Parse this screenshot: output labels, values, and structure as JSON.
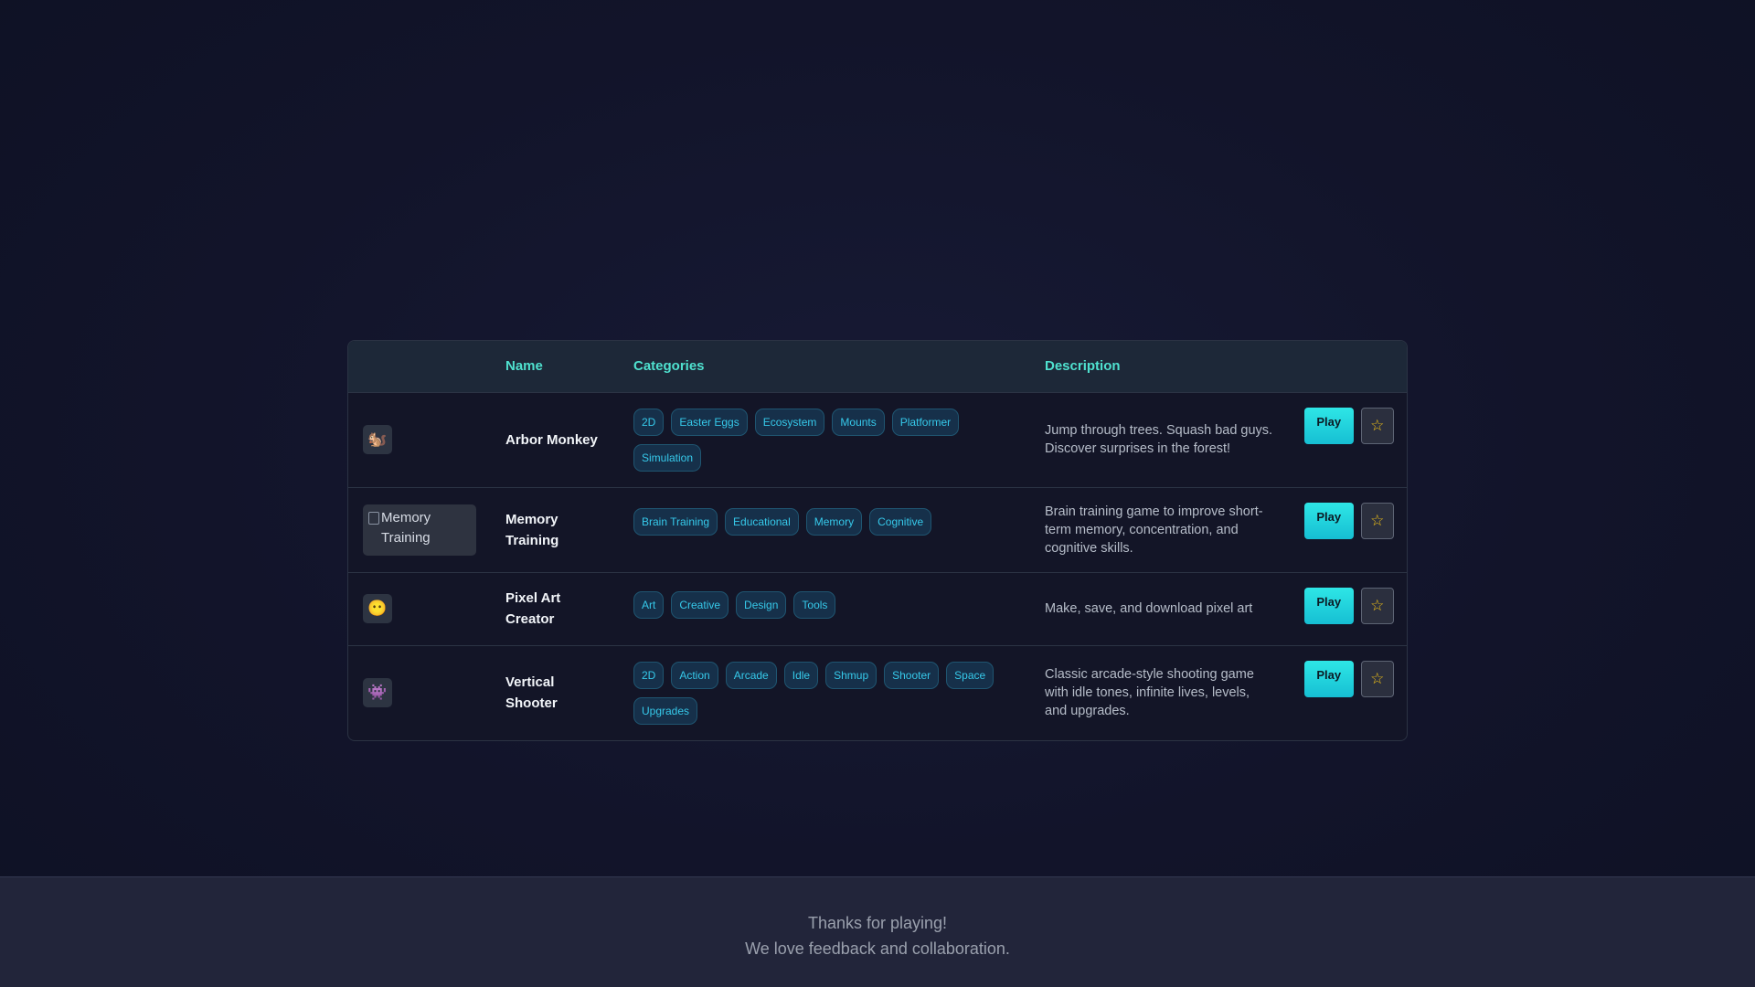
{
  "table": {
    "headers": {
      "thumb": "",
      "name": "Name",
      "categories": "Categories",
      "description": "Description"
    },
    "rows": [
      {
        "thumb_icon": "squirrel-icon",
        "thumb_glyph": "🐿️",
        "name": "Arbor Monkey",
        "tags": [
          "2D",
          "Easter Eggs",
          "Ecosystem",
          "Mounts",
          "Platformer",
          "Simulation"
        ],
        "description": "Jump through trees. Squash bad guys. Discover surprises in the forest!",
        "play_label": "Play",
        "fav_glyph": "☆"
      },
      {
        "thumb_alt": "Memory Training",
        "name": "Memory Training",
        "tags": [
          "Brain Training",
          "Educational",
          "Memory",
          "Cognitive"
        ],
        "description": "Brain training game to improve short-term memory, concentration, and cognitive skills.",
        "play_label": "Play",
        "fav_glyph": "☆"
      },
      {
        "thumb_icon": "smiley-icon",
        "thumb_glyph": "😶",
        "name": "Pixel Art Creator",
        "tags": [
          "Art",
          "Creative",
          "Design",
          "Tools"
        ],
        "description": "Make, save, and download pixel art",
        "play_label": "Play",
        "fav_glyph": "☆"
      },
      {
        "thumb_icon": "arcade-ship-icon",
        "thumb_glyph": "👾",
        "name": "Vertical Shooter",
        "tags": [
          "2D",
          "Action",
          "Arcade",
          "Idle",
          "Shmup",
          "Shooter",
          "Space",
          "Upgrades"
        ],
        "description": "Classic arcade-style shooting game with idle tones, infinite lives, levels, and upgrades.",
        "play_label": "Play",
        "fav_glyph": "☆"
      }
    ]
  },
  "footer": {
    "line1": "Thanks for playing!",
    "line2": "We love feedback and collaboration."
  },
  "colors": {
    "accent": "#4fe1cf",
    "play": "#1fd6dc",
    "star": "#f3c316",
    "tag_text": "#36c9ea"
  }
}
